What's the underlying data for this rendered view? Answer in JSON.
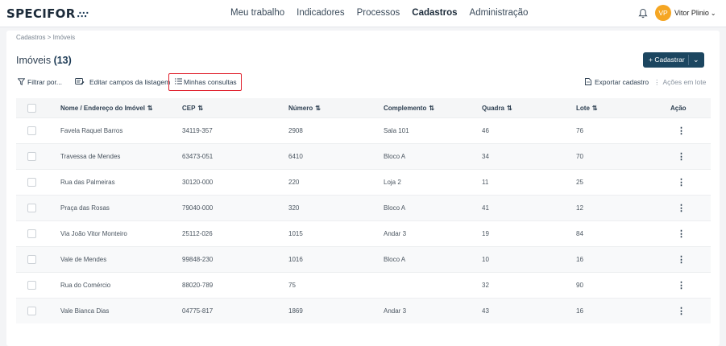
{
  "header": {
    "logo": "SPECIFOR",
    "logo_mark": "∴∵",
    "nav": [
      "Meu trabalho",
      "Indicadores",
      "Processos",
      "Cadastros",
      "Administração"
    ],
    "active_nav": "Cadastros",
    "avatar_initials": "VP",
    "user_name": "Vitor Plinio",
    "user_chevron": "⌄",
    "avatar_color": "#f5a623"
  },
  "breadcrumb": "Cadastros  >  Imóveis",
  "page": {
    "title": "Imóveis",
    "count": "(13)"
  },
  "cadastrar_button": {
    "label": "+ Cadastrar",
    "dropdown": "⌄",
    "color": "#1c4660"
  },
  "toolbar": {
    "filter": "Filtrar por...",
    "edit_fields": "Editar campos da listagem",
    "my_queries": "Minhas consultas",
    "export": "Exportar cadastro",
    "bulk_actions": "Ações em lote",
    "highlight_color": "#e0212d"
  },
  "table": {
    "columns": [
      "Nome / Endereço do Imóvel",
      "CEP",
      "Número",
      "Complemento",
      "Quadra",
      "Lote",
      "Ação"
    ],
    "sort_icon": "⇅",
    "action_icon": "⋮",
    "rows": [
      [
        "Favela Raquel Barros",
        "34119-357",
        "2908",
        "Sala 101",
        "46",
        "76"
      ],
      [
        "Travessa de Mendes",
        "63473-051",
        "6410",
        "Bloco A",
        "34",
        "70"
      ],
      [
        "Rua das Palmeiras",
        "30120-000",
        "220",
        "Loja 2",
        "11",
        "25"
      ],
      [
        "Praça das Rosas",
        "79040-000",
        "320",
        "Bloco A",
        "41",
        "12"
      ],
      [
        "Via João Vitor Monteiro",
        "25112-026",
        "1015",
        "Andar 3",
        "19",
        "84"
      ],
      [
        "Vale de Mendes",
        "99848-230",
        "1016",
        "Bloco A",
        "10",
        "16"
      ],
      [
        "Rua do Comércio",
        "88020-789",
        "75",
        "",
        "32",
        "90"
      ],
      [
        "Vale Bianca Dias",
        "04775-817",
        "1869",
        "Andar 3",
        "43",
        "16"
      ]
    ]
  }
}
